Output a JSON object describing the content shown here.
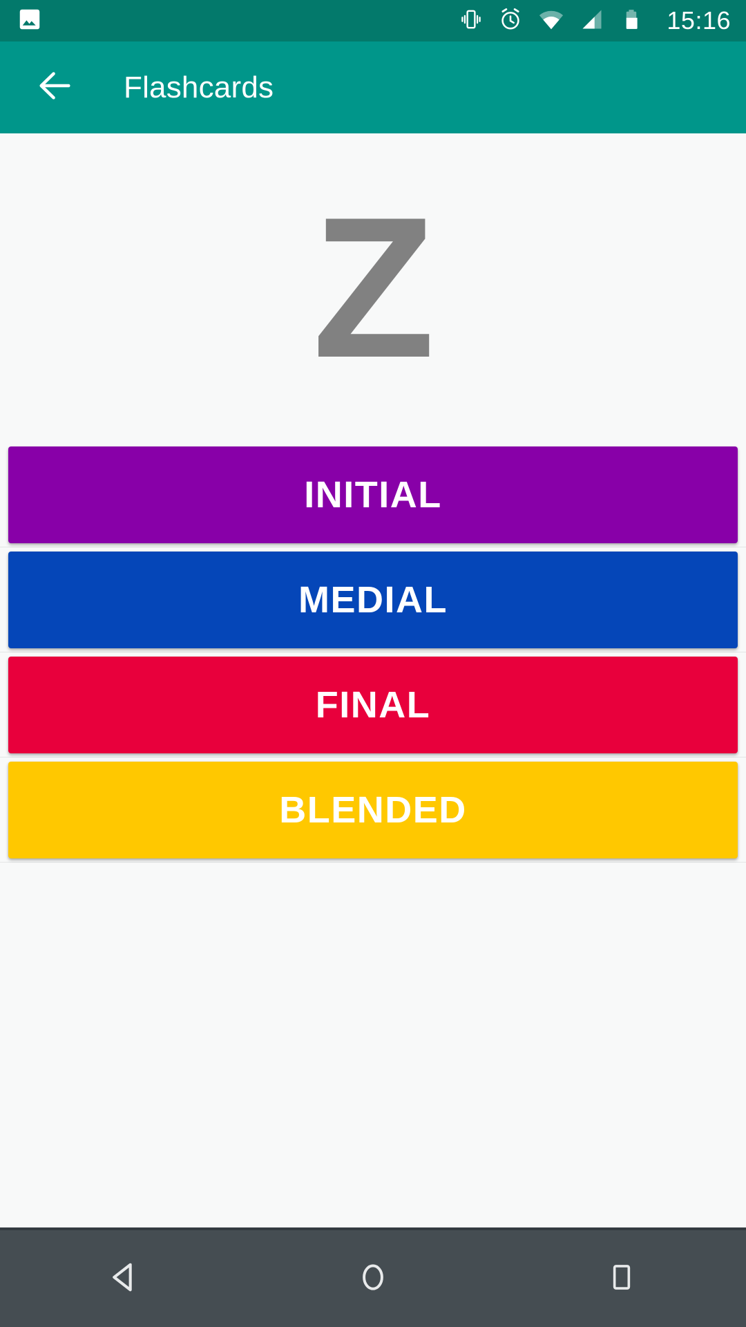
{
  "status_bar": {
    "background_color": "#03796b",
    "time": "15:16",
    "icons": [
      {
        "name": "gallery-notification-icon",
        "glyph": "image"
      },
      {
        "name": "vibrate-icon",
        "glyph": "vibrate"
      },
      {
        "name": "alarm-icon",
        "glyph": "alarm-clock"
      },
      {
        "name": "wifi-icon",
        "glyph": "wifi"
      },
      {
        "name": "cell-signal-icon",
        "glyph": "signal"
      },
      {
        "name": "battery-icon",
        "glyph": "battery"
      }
    ]
  },
  "toolbar": {
    "background_color": "#00968a",
    "back_label": "Back",
    "title": "Flashcards"
  },
  "card": {
    "letter": "Z",
    "letter_color": "#818181"
  },
  "buttons": [
    {
      "label": "INITIAL",
      "color": "#8800a8",
      "text_color": "#ffffff"
    },
    {
      "label": "MEDIAL",
      "color": "#0546b8",
      "text_color": "#ffffff"
    },
    {
      "label": "FINAL",
      "color": "#e8003c",
      "text_color": "#ffffff"
    },
    {
      "label": "BLENDED",
      "color": "#ffc800",
      "text_color": "#ffffff"
    }
  ],
  "nav_bar": {
    "background_color": "#454d52",
    "items": [
      {
        "name": "nav-back",
        "label": "Back"
      },
      {
        "name": "nav-home",
        "label": "Home"
      },
      {
        "name": "nav-recents",
        "label": "Recents"
      }
    ]
  }
}
